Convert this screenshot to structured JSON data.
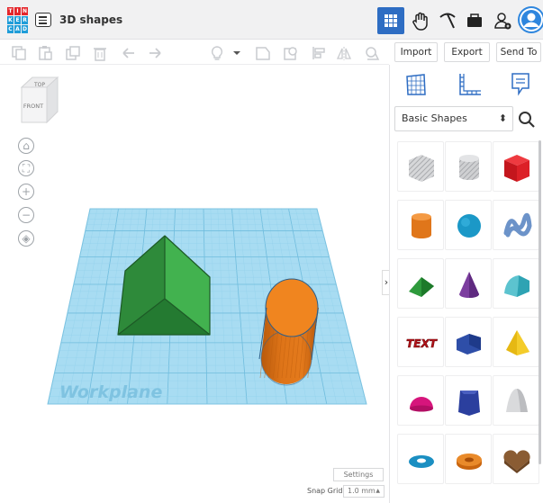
{
  "app": {
    "logo_letters": [
      "T",
      "I",
      "N",
      "K",
      "E",
      "R",
      "C",
      "A",
      "D"
    ],
    "logo_colors": [
      "#e5262b",
      "#e5262b",
      "#e5262b",
      "#1f9dd9",
      "#1f9dd9",
      "#1f9dd9",
      "#1f9dd9",
      "#1f9dd9",
      "#1f9dd9"
    ],
    "design_title": "3D shapes",
    "brand_blue": "#2e6dc3"
  },
  "topbar": {
    "icons": [
      "grid-view-icon",
      "hand-icon",
      "pickaxe-icon",
      "briefcase-icon",
      "add-user-icon",
      "avatar"
    ]
  },
  "toolbar": {
    "tools": [
      "copy-icon",
      "paste-icon",
      "duplicate-icon",
      "delete-icon",
      "undo-icon",
      "redo-icon",
      "light-bulb-icon",
      "dropdown-caret-icon",
      "shape-solid-icon",
      "shape-hole-icon",
      "align-icon",
      "mirror-icon",
      "group-icon"
    ],
    "import_label": "Import",
    "export_label": "Export",
    "send_to_label": "Send To"
  },
  "viewcube": {
    "top_label": "TOP",
    "front_label": "FRONT"
  },
  "nav_controls": [
    "home-view-icon",
    "fit-view-icon",
    "zoom-in-icon",
    "zoom-out-icon",
    "orthographic-icon"
  ],
  "workplane": {
    "label": "Workplane",
    "color": "#a8dcf2",
    "grid_color": "#7ec7e6"
  },
  "scene_shapes": [
    {
      "name": "roof",
      "colors": [
        "#2f8d3c",
        "#3fb34d",
        "#226c2d"
      ]
    },
    {
      "name": "cylinder",
      "colors": [
        "#f0851f",
        "#cc6611"
      ]
    }
  ],
  "footer": {
    "settings_label": "Settings",
    "snap_grid_label": "Snap Grid",
    "snap_grid_value": "1.0 mm"
  },
  "panel": {
    "category_tabs": [
      "grid-panel-icon",
      "ruler-icon",
      "notes-icon"
    ],
    "category": "Basic Shapes",
    "shapes": [
      "box-hole",
      "cylinder-hole",
      "box",
      "cylinder",
      "sphere",
      "scribble",
      "roof",
      "cone",
      "round-roof",
      "text",
      "polygon",
      "pyramid",
      "half-sphere",
      "polygon-prism",
      "paraboloid",
      "torus",
      "tube",
      "heart"
    ],
    "text_shape_label": "TEXT"
  }
}
